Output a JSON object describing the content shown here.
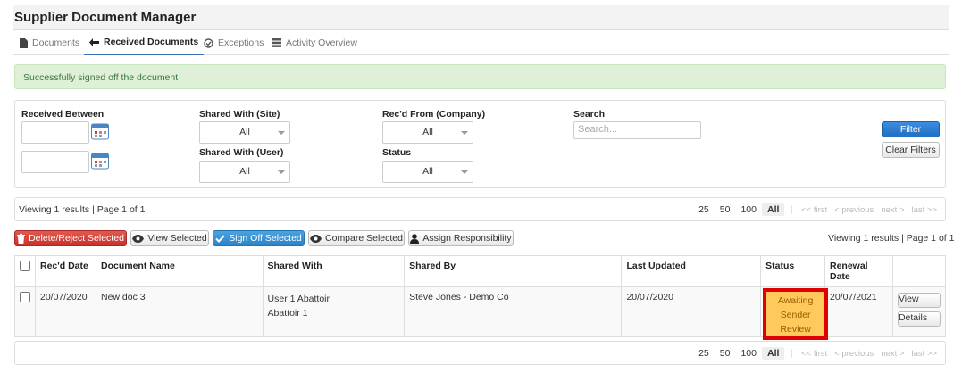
{
  "app": {
    "title": "Supplier Document Manager"
  },
  "tabs": [
    {
      "label": "Documents",
      "icon": "document-icon"
    },
    {
      "label": "Received Documents",
      "icon": "arrow-left-icon"
    },
    {
      "label": "Exceptions",
      "icon": "check-circle-icon"
    },
    {
      "label": "Activity Overview",
      "icon": "list-icon"
    }
  ],
  "alert": {
    "text": "Successfully signed off the document"
  },
  "filters": {
    "received_between_label": "Received Between",
    "shared_with_site_label": "Shared With (Site)",
    "shared_with_site_value": "All",
    "shared_with_user_label": "Shared With (User)",
    "shared_with_user_value": "All",
    "recd_from_company_label": "Rec'd From (Company)",
    "recd_from_company_value": "All",
    "status_label": "Status",
    "status_value": "All",
    "search_label": "Search",
    "search_placeholder": "Search...",
    "filter_button": "Filter",
    "clear_button": "Clear Filters"
  },
  "pager": {
    "viewing_text": "Viewing 1 results | Page 1 of 1",
    "sizes": [
      "25",
      "50",
      "100",
      "All"
    ],
    "separator": "|",
    "first": "<< first",
    "previous": "< previous",
    "next": "next >",
    "last": "last >>"
  },
  "actions": {
    "delete_reject": "Delete/Reject Selected",
    "view_selected": "View Selected",
    "sign_off_selected": "Sign Off Selected",
    "compare_selected": "Compare Selected",
    "assign_responsibility": "Assign Responsibility",
    "viewing_text": "Viewing 1 results | Page 1 of 1"
  },
  "table": {
    "headers": [
      "Rec'd Date",
      "Document Name",
      "Shared With",
      "Shared By",
      "Last Updated",
      "Status",
      "Renewal Date"
    ],
    "rows": [
      {
        "recd_date": "20/07/2020",
        "document_name": "New doc 3",
        "shared_with_1": "User 1 Abattoir",
        "shared_with_2": "Abattoir 1",
        "shared_by": "Steve Jones - Demo Co",
        "last_updated": "20/07/2020",
        "status_1": "Awaiting",
        "status_2": "Sender",
        "status_3": "Review",
        "renewal_date": "20/07/2021",
        "view_button": "View",
        "details_button": "Details"
      }
    ]
  },
  "colors": {
    "primary": "#1f6fc2",
    "danger": "#c9302c",
    "success_bg": "#dff0d8",
    "status_bg": "#ffc95c",
    "highlight": "#e00000"
  }
}
